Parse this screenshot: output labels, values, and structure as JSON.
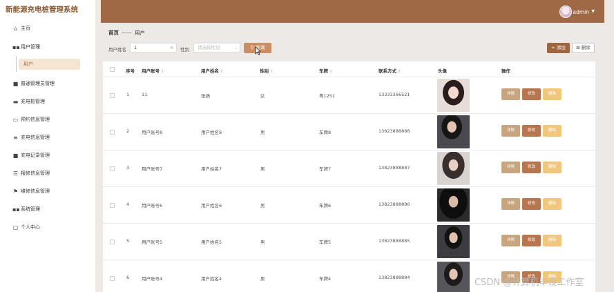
{
  "app": {
    "title": "新能源充电桩管理系统"
  },
  "header": {
    "user": "admin"
  },
  "sidebar": {
    "items": [
      {
        "label": "主页",
        "icon": "home-icon"
      },
      {
        "label": "用户管理",
        "icon": "grid-icon"
      },
      {
        "label": "普通管理员管理",
        "icon": "lock-icon"
      },
      {
        "label": "充电桩管理",
        "icon": "monitor-icon"
      },
      {
        "label": "预约信息管理",
        "icon": "ticket-icon"
      },
      {
        "label": "充电信息管理",
        "icon": "list-icon"
      },
      {
        "label": "充电记录管理",
        "icon": "lock-icon"
      },
      {
        "label": "报修信息管理",
        "icon": "sliders-icon"
      },
      {
        "label": "维修信息管理",
        "icon": "flag-icon"
      },
      {
        "label": "系统管理",
        "icon": "grid-icon"
      },
      {
        "label": "个人中心",
        "icon": "calendar-icon"
      }
    ],
    "subitem": "用户"
  },
  "breadcrumb": {
    "home": "首页",
    "sep": "——",
    "current": "用户"
  },
  "search": {
    "name_label": "用户姓名",
    "name_value": "1",
    "gender_label": "性别",
    "gender_placeholder": "请选择性别",
    "query_label": "查询"
  },
  "actions": {
    "add": "添加",
    "delete": "删除"
  },
  "table": {
    "columns": [
      "序号",
      "用户账号",
      "用户姓名",
      "性别",
      "车牌",
      "联系方式",
      "头像",
      "操作"
    ],
    "buttons": {
      "detail": "详情",
      "edit": "修改",
      "delete": "删除"
    },
    "rows": [
      {
        "no": "1",
        "account": "11",
        "name": "张扬",
        "gender": "女",
        "plate": "粤1251",
        "phone": "13333366521"
      },
      {
        "no": "2",
        "account": "用户账号8",
        "name": "用户姓名8",
        "gender": "男",
        "plate": "车牌8",
        "phone": "13823888888"
      },
      {
        "no": "3",
        "account": "用户账号7",
        "name": "用户姓名7",
        "gender": "男",
        "plate": "车牌7",
        "phone": "13823888887"
      },
      {
        "no": "4",
        "account": "用户账号6",
        "name": "用户姓名6",
        "gender": "男",
        "plate": "车牌6",
        "phone": "13823888886"
      },
      {
        "no": "5",
        "account": "用户账号5",
        "name": "用户姓名5",
        "gender": "男",
        "plate": "车牌5",
        "phone": "13823888885"
      },
      {
        "no": "6",
        "account": "用户账号4",
        "name": "用户姓名4",
        "gender": "男",
        "plate": "车牌4",
        "phone": "13823888884"
      }
    ]
  },
  "watermark": "CSDN @计算机毕设工作室",
  "colors": {
    "brand": "#a06945",
    "query": "#c98f62",
    "detail": "#c8a57f",
    "edit": "#b87650",
    "delete": "#f1c87b"
  }
}
